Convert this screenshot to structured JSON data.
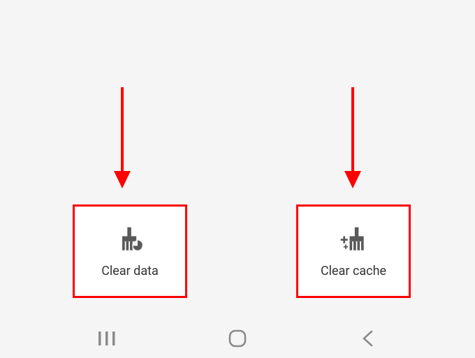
{
  "storage_actions": {
    "clear_data": {
      "label": "Clear data"
    },
    "clear_cache": {
      "label": "Clear cache"
    }
  },
  "annotations": {
    "arrow_color": "#ff0000",
    "box_color": "#ff0000"
  },
  "nav": {
    "recents": "recents",
    "home": "home",
    "back": "back"
  },
  "icon_color": "#595959"
}
